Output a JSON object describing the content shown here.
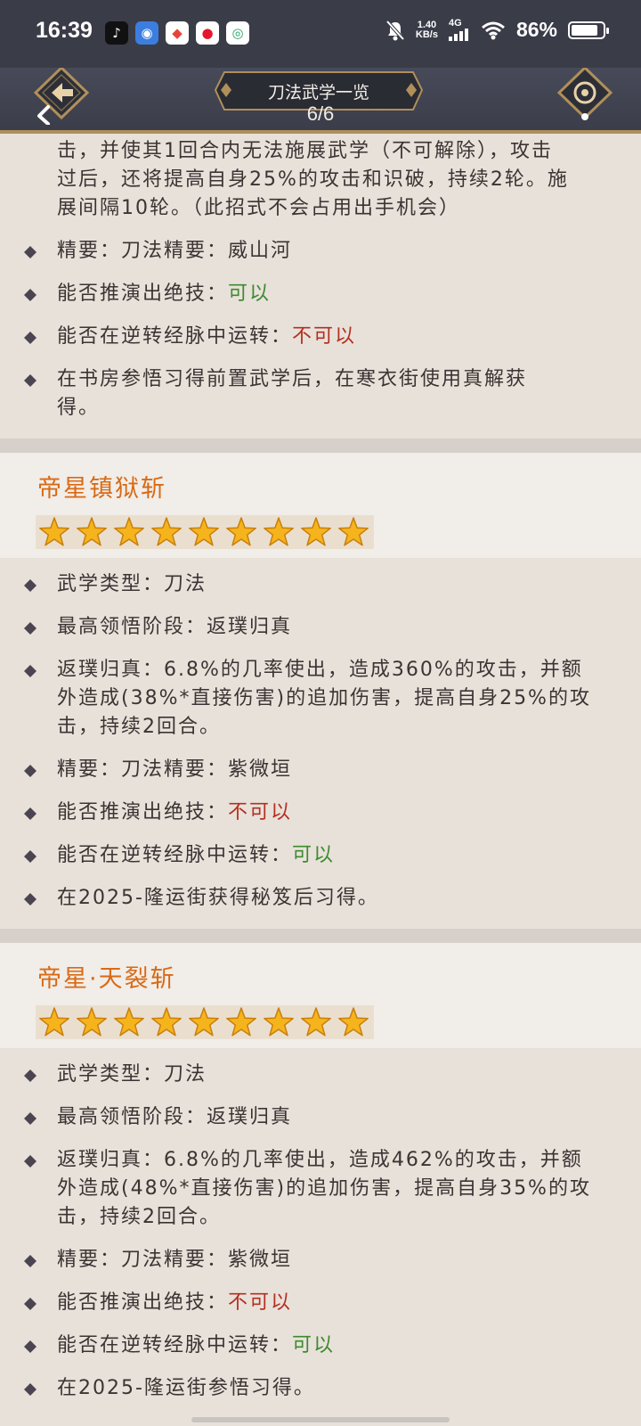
{
  "status_bar": {
    "time": "16:39",
    "apps": [
      {
        "icon": "tiktok-icon",
        "glyph": "♪",
        "color": "#111111"
      },
      {
        "icon": "app-blue-icon",
        "glyph": "◉",
        "color": "#3b7ee0"
      },
      {
        "icon": "map-pin-icon",
        "glyph": "◆",
        "color": "#e8443a"
      },
      {
        "icon": "weibo-icon",
        "glyph": "●",
        "color": "#e6162d"
      },
      {
        "icon": "mobile-carrier-icon",
        "glyph": "◎",
        "color": "#2aa26a"
      }
    ],
    "speed_value": "1.40",
    "speed_unit": "KB/s",
    "network": "4G",
    "battery_text": "86%",
    "battery_level": 0.86
  },
  "header": {
    "title": "刀法武学一览",
    "page_indicator": "6/6"
  },
  "top_continuation": {
    "desc_lines": [
      "击，并使其1回合内无法施展武学（不可解除），攻击",
      "过后，还将提高自身25%的攻击和识破，持续2轮。施",
      "展间隔10轮。（此招式不会占用出手机会）"
    ],
    "rows": [
      {
        "text": "精要：刀法精要：威山河"
      },
      {
        "label": "能否推演出绝技：",
        "value": "可以",
        "positive": true
      },
      {
        "label": "能否在逆转经脉中运转：",
        "value": "不可以",
        "positive": false
      },
      {
        "lines": [
          "在书房参悟习得前置武学后，在寒衣街使用真解获",
          "得。"
        ]
      }
    ]
  },
  "sections": [
    {
      "title": "帝星镇狱斩",
      "stars": 9,
      "type_row": "武学类型：刀法",
      "stage_row": "最高领悟阶段：返璞归真",
      "effect_lines": [
        "返璞归真：6.8%的几率使出，造成360%的攻击，并额",
        "外造成(38%*直接伤害)的追加伤害，提高自身25%的攻",
        "击，持续2回合。"
      ],
      "essence_row": "精要：刀法精要：紫微垣",
      "deduce_label": "能否推演出绝技：",
      "deduce_value": "不可以",
      "meridian_label": "能否在逆转经脉中运转：",
      "meridian_value": "可以",
      "source_row": "在2025-隆运街获得秘笈后习得。"
    },
    {
      "title": "帝星·天裂斩",
      "stars": 9,
      "type_row": "武学类型：刀法",
      "stage_row": "最高领悟阶段：返璞归真",
      "effect_lines": [
        "返璞归真：6.8%的几率使出，造成462%的攻击，并额",
        "外造成(48%*直接伤害)的追加伤害，提高自身35%的攻",
        "击，持续2回合。"
      ],
      "essence_row": "精要：刀法精要：紫微垣",
      "deduce_label": "能否推演出绝技：",
      "deduce_value": "不可以",
      "meridian_label": "能否在逆转经脉中运转：",
      "meridian_value": "可以",
      "source_row": "在2025-隆运街参悟习得。"
    }
  ],
  "colors": {
    "accent_orange": "#d86a16",
    "positive_green": "#3d8a2e",
    "negative_red": "#b33020",
    "header_bg": "#3b3d4a",
    "gold_trim": "#b08f5a"
  }
}
